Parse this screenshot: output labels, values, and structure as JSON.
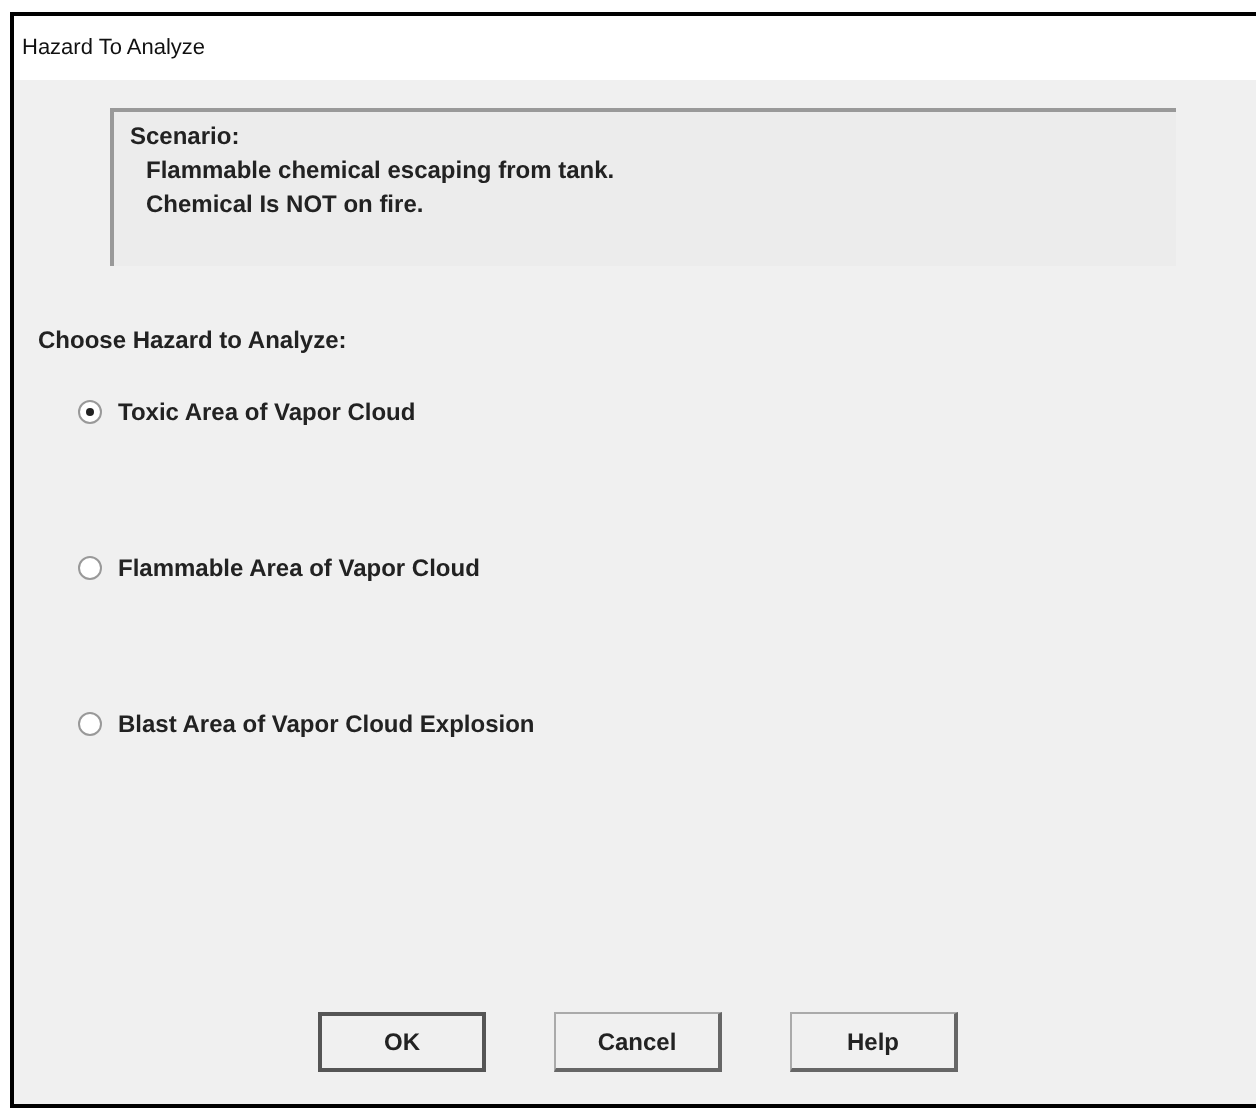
{
  "window": {
    "title": "Hazard To Analyze"
  },
  "scenario": {
    "heading": "Scenario:",
    "lines": [
      "Flammable chemical escaping from tank.",
      "Chemical Is NOT on fire."
    ]
  },
  "prompt": "Choose Hazard to Analyze:",
  "options": [
    {
      "label": "Toxic Area of Vapor Cloud",
      "selected": true
    },
    {
      "label": "Flammable Area of Vapor Cloud",
      "selected": false
    },
    {
      "label": "Blast Area of Vapor Cloud Explosion",
      "selected": false
    }
  ],
  "buttons": [
    {
      "label": "OK",
      "default": true
    },
    {
      "label": "Cancel",
      "default": false
    },
    {
      "label": "Help",
      "default": false
    }
  ]
}
